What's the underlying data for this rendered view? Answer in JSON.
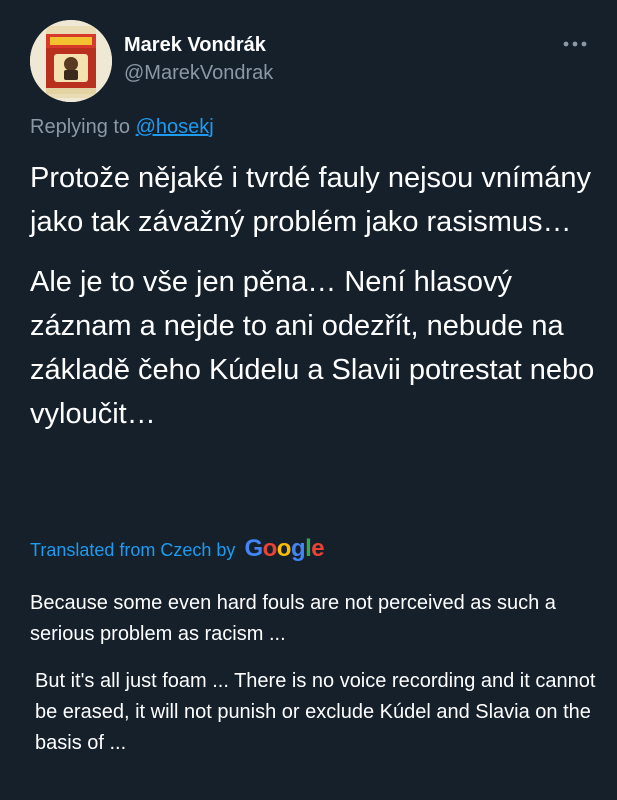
{
  "tweet": {
    "author": {
      "display_name": "Marek Vondrák",
      "handle": "@MarekVondrak",
      "avatar_icon": "product-can-avatar"
    },
    "more_icon": "more-horizontal-icon",
    "replying": {
      "prefix": "Replying to",
      "handle": "@hosekj"
    },
    "text_paragraphs": [
      "Protože nějaké i tvrdé fauly nejsou vnímány jako tak závažný problém jako rasismus…",
      "Ale je to vše jen pěna… Není hlasový záznam a nejde to ani odezřít, nebude na základě čeho Kúdelu a Slavii potrestat nebo vyloučit…"
    ],
    "translation": {
      "label": "Translated from Czech by",
      "provider": "Google",
      "paragraphs": [
        "Because some even hard fouls are not perceived as such a serious problem as racism ...",
        "But it's all just foam ... There is no voice recording and it cannot be erased, it will not punish or exclude Kúdel and Slavia on the basis of ..."
      ]
    }
  },
  "colors": {
    "background": "#15202b",
    "primary_text": "#ffffff",
    "secondary_text": "#8b98a5",
    "link": "#1d9bf0"
  }
}
